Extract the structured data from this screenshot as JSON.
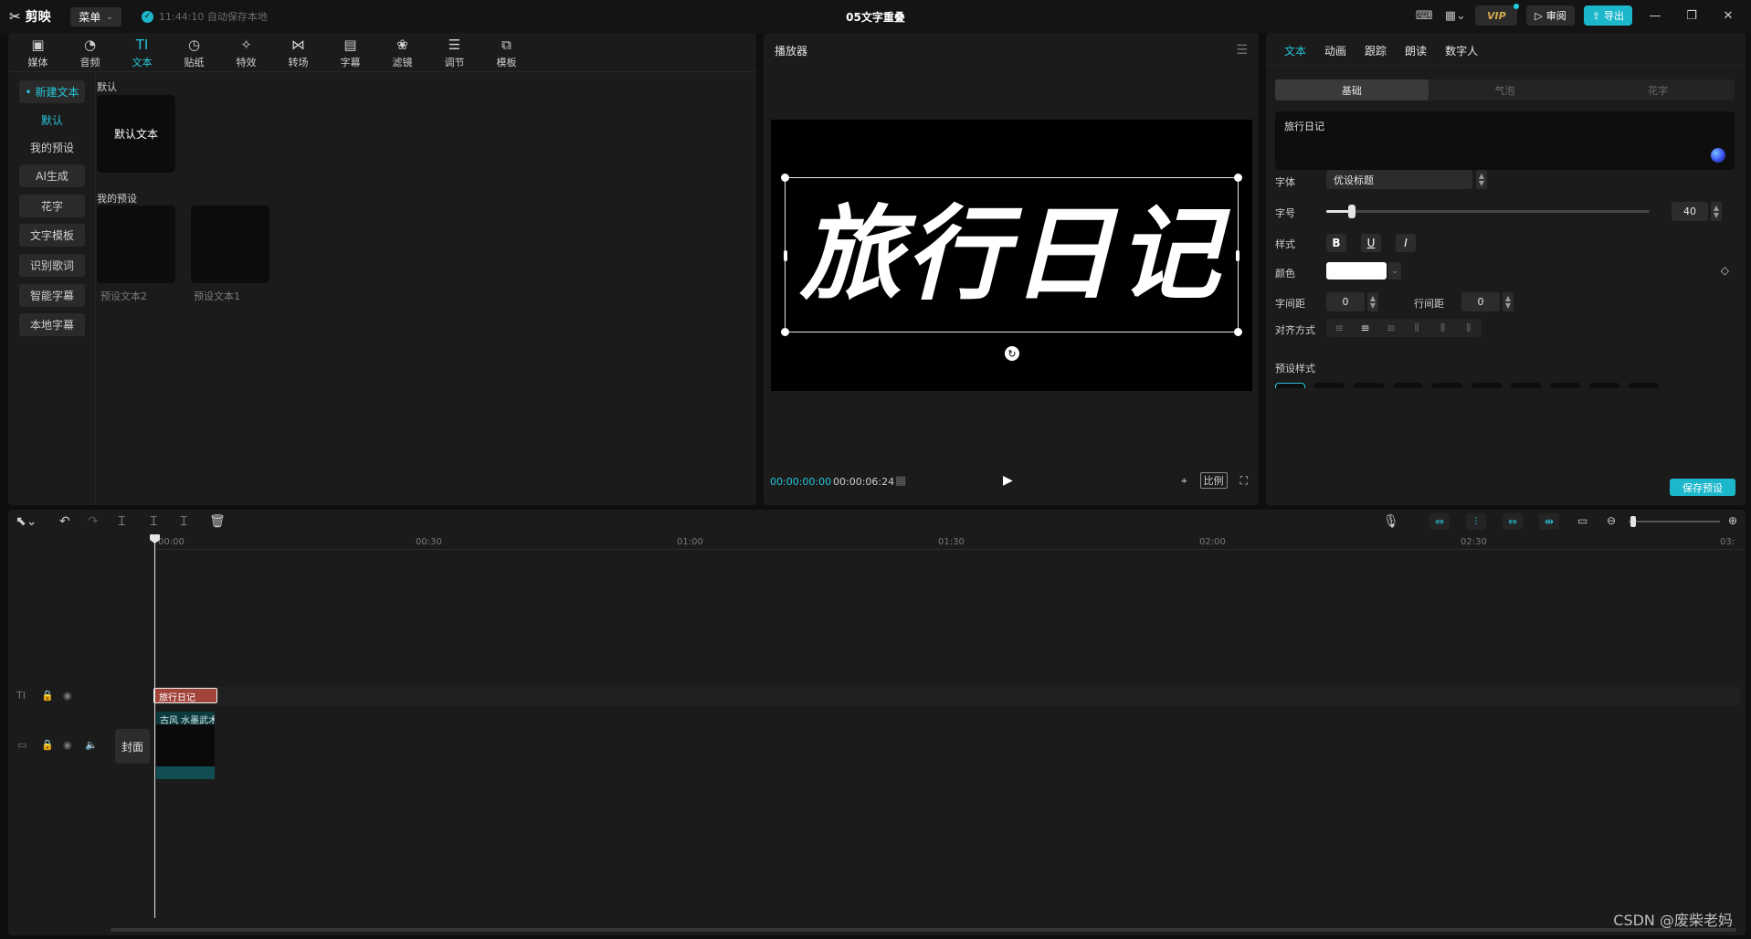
{
  "titlebar": {
    "app_name": "剪映",
    "menu_label": "菜单",
    "save_status": "11:44:10 自动保存本地",
    "doc_title": "05文字重叠",
    "vip_label": "VIP",
    "review_label": "审阅",
    "export_label": "导出"
  },
  "toolbar": {
    "tabs": [
      {
        "label": "媒体",
        "icon": "media-icon"
      },
      {
        "label": "音频",
        "icon": "audio-icon"
      },
      {
        "label": "文本",
        "icon": "text-icon",
        "active": true
      },
      {
        "label": "贴纸",
        "icon": "sticker-icon"
      },
      {
        "label": "特效",
        "icon": "effects-icon"
      },
      {
        "label": "转场",
        "icon": "transition-icon"
      },
      {
        "label": "字幕",
        "icon": "subtitle-icon"
      },
      {
        "label": "滤镜",
        "icon": "filter-icon"
      },
      {
        "label": "调节",
        "icon": "adjust-icon"
      },
      {
        "label": "模板",
        "icon": "template-icon"
      }
    ]
  },
  "sidebar": {
    "items": [
      {
        "label": "• 新建文本",
        "selected": true
      },
      {
        "label": "默认"
      },
      {
        "label": "我的预设"
      },
      {
        "label": "AI生成"
      },
      {
        "label": "花字"
      },
      {
        "label": "文字模板"
      },
      {
        "label": "识别歌词"
      },
      {
        "label": "智能字幕"
      },
      {
        "label": "本地字幕"
      }
    ]
  },
  "library": {
    "default_section": "默认",
    "default_item": "默认文本",
    "preset_section": "我的预设",
    "presets": [
      "预设文本2",
      "预设文本1"
    ]
  },
  "player": {
    "title": "播放器",
    "overlay_text": "旅行日记",
    "current_time": "00:00:00:00",
    "total_time": "00:00:06:24",
    "ratio_label": "比例"
  },
  "inspector": {
    "tabs": [
      "文本",
      "动画",
      "跟踪",
      "朗读",
      "数字人"
    ],
    "sub_tabs": [
      "基础",
      "气泡",
      "花字"
    ],
    "text_value": "旅行日记",
    "font_label": "字体",
    "font_value": "优设标题",
    "size_label": "字号",
    "size_value": "40",
    "size_fraction": 0.08,
    "style_label": "样式",
    "style_buttons": [
      "B",
      "U",
      "I"
    ],
    "color_label": "颜色",
    "color_value": "#ffffff",
    "letter_spacing_label": "字间距",
    "letter_spacing_value": "0",
    "line_spacing_label": "行间距",
    "line_spacing_value": "0",
    "align_label": "对齐方式",
    "preset_style_label": "预设样式",
    "save_preset_label": "保存预设"
  },
  "timeline": {
    "ruler": [
      "00:00",
      "00:30",
      "01:00",
      "01:30",
      "02:00",
      "02:30",
      "03:"
    ],
    "text_clip": "旅行日记",
    "video_clip": "古风 水墨武术",
    "cover_label": "封面",
    "zoom_fraction": 0.02
  },
  "watermark": "CSDN @废柴老妈",
  "colors": {
    "accent": "#26c6da",
    "export": "#1db7cc",
    "text_clip": "#a2433a",
    "panel": "#1b1b1b"
  }
}
